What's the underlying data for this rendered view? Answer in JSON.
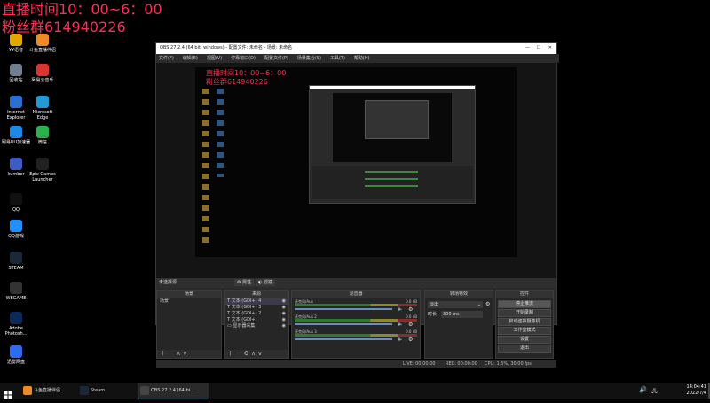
{
  "overlay": {
    "line1": "直播时间10：00~6：00",
    "line2": "粉丝群614940226"
  },
  "desktop": {
    "icons": [
      {
        "name": "YY语音",
        "color": "#e0a800"
      },
      {
        "name": "斗鱼直播伴侣",
        "color": "#f08a24"
      },
      {
        "name": "回收站",
        "color": "#6f7f8f"
      },
      {
        "name": "网易云音乐",
        "color": "#d33"
      },
      {
        "name": "Internet Explorer",
        "color": "#2a6fd1"
      },
      {
        "name": "Microsoft Edge",
        "color": "#1f9ad6"
      },
      {
        "name": "网易UU加速器",
        "color": "#1e88e5"
      },
      {
        "name": "微信",
        "color": "#2bb24c"
      },
      {
        "name": "kumber",
        "color": "#3f5bc7"
      },
      {
        "name": "Epic Games Launcher",
        "color": "#222"
      },
      {
        "name": "QQ",
        "color": "#111"
      },
      {
        "name": "QQ游戏",
        "color": "#1e90ff"
      },
      {
        "name": "STEAM",
        "color": "#1b2838"
      },
      {
        "name": "WEGAME",
        "color": "#333"
      },
      {
        "name": "Adobe Photosh...",
        "color": "#0b2a57"
      },
      {
        "name": "迅雷网盘",
        "color": "#2b6cf0"
      }
    ]
  },
  "obs": {
    "title": "OBS 27.2.4 (64 bit, windows) - 配置文件: 未命名 - 场景: 未命名",
    "menu": [
      "文件(F)",
      "编辑(E)",
      "视图(V)",
      "停靠窗口(D)",
      "配置文件(P)",
      "场景集合(S)",
      "工具(T)",
      "帮助(H)"
    ],
    "preview_overlay": [
      "直播时间10：00~6：00",
      "粉丝群614940226"
    ],
    "control_bar": {
      "label": "未选择源",
      "properties": "属性",
      "filters": "滤镜"
    },
    "docks": {
      "scenes": {
        "title": "场景",
        "items": [
          "场景"
        ]
      },
      "sources": {
        "title": "来源",
        "items": [
          "文本 (GDI+) 4",
          "文本 (GDI+) 3",
          "文本 (GDI+) 2",
          "文本 (GDI+)",
          "显示器采集"
        ]
      },
      "mixer": {
        "title": "混音器",
        "tracks": [
          {
            "name": "麦克风/Aux",
            "db": "0.0 dB"
          },
          {
            "name": "麦克风/Aux 2",
            "db": "0.0 dB"
          },
          {
            "name": "麦克风/Aux 3",
            "db": "0.0 dB"
          }
        ]
      },
      "transitions": {
        "title": "转场特效",
        "type": "淡出",
        "duration_label": "时长",
        "duration_value": "300 ms"
      },
      "controls": {
        "title": "控件",
        "buttons": [
          "停止推流",
          "开始录制",
          "启动虚拟摄像机",
          "工作室模式",
          "设置",
          "退出"
        ]
      }
    },
    "status": {
      "live": "LIVE: 00:00:00",
      "rec": "REC: 00:00:00",
      "cpu": "CPU: 1.5%, 30.00 fps"
    }
  },
  "taskbar": {
    "items": [
      {
        "label": "斗鱼直播伴侣",
        "color": "#f08a24"
      },
      {
        "label": "Steam",
        "color": "#1b2838"
      },
      {
        "label": "OBS 27.2.4 (64-bi...",
        "color": "#444"
      }
    ],
    "time": "14:04:41",
    "date": "2022/7/4"
  }
}
